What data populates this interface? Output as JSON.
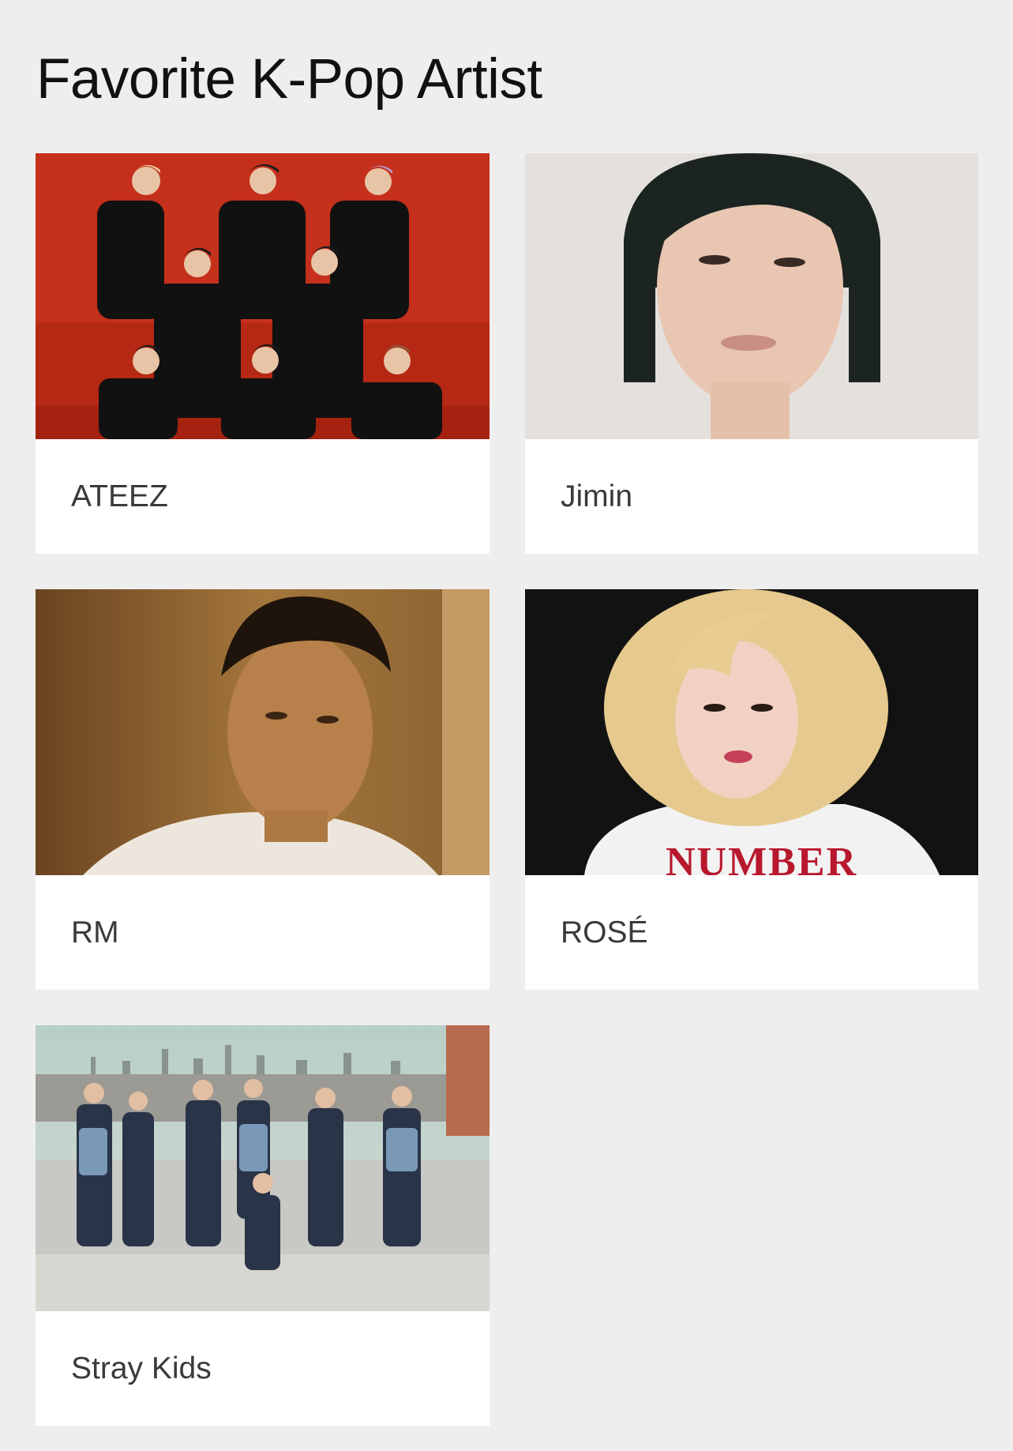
{
  "page": {
    "title": "Favorite K-Pop Artist"
  },
  "artists": [
    {
      "name": "ATEEZ"
    },
    {
      "name": "Jimin"
    },
    {
      "name": "RM"
    },
    {
      "name": "ROSÉ"
    },
    {
      "name": "Stray Kids"
    }
  ],
  "photo_text": {
    "rose_shirt": "NUMBER"
  },
  "colors": {
    "page_background": "#eeeeee",
    "card_background": "#ffffff",
    "label_text": "#3a3a3a",
    "title_text": "#111111"
  }
}
